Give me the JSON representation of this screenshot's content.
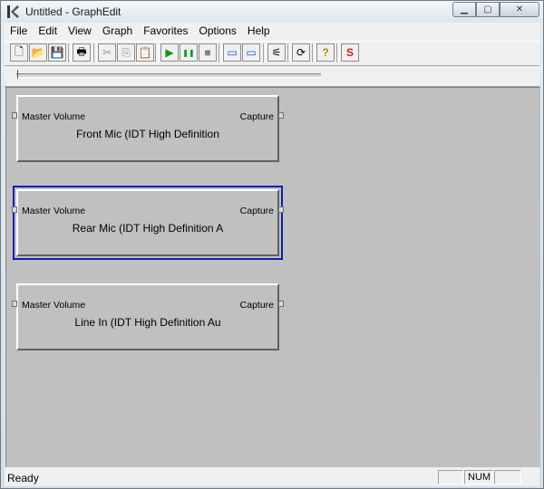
{
  "window": {
    "title": "Untitled - GraphEdit"
  },
  "menu": [
    "File",
    "Edit",
    "View",
    "Graph",
    "Favorites",
    "Options",
    "Help"
  ],
  "toolbar": [
    {
      "name": "new-icon",
      "glyph": "🗋"
    },
    {
      "name": "open-icon",
      "glyph": "📂"
    },
    {
      "name": "save-icon",
      "glyph": "💾"
    },
    {
      "name": "print-icon",
      "glyph": "🖶"
    },
    {
      "name": "cut-icon",
      "glyph": "✂"
    },
    {
      "name": "copy-icon",
      "glyph": "⎘"
    },
    {
      "name": "paste-icon",
      "glyph": "📋"
    },
    {
      "name": "play-icon",
      "glyph": "▶"
    },
    {
      "name": "pause-icon",
      "glyph": "❚❚"
    },
    {
      "name": "stop-icon",
      "glyph": "■"
    },
    {
      "name": "seek-start-icon",
      "glyph": "▭"
    },
    {
      "name": "frame-step-icon",
      "glyph": "▭"
    },
    {
      "name": "render-file-icon",
      "glyph": "⚟"
    },
    {
      "name": "refresh-icon",
      "glyph": "⟳"
    },
    {
      "name": "help-icon",
      "glyph": "?"
    },
    {
      "name": "sync-icon",
      "glyph": "S"
    }
  ],
  "filters": [
    {
      "input_pin": "Master Volume",
      "output_pin": "Capture",
      "name": "Front Mic (IDT High Definition",
      "selected": false
    },
    {
      "input_pin": "Master Volume",
      "output_pin": "Capture",
      "name": "Rear Mic (IDT High Definition A",
      "selected": true
    },
    {
      "input_pin": "Master Volume",
      "output_pin": "Capture",
      "name": "Line In (IDT High Definition Au",
      "selected": false
    }
  ],
  "status": {
    "text": "Ready",
    "num": "NUM"
  },
  "colors": {
    "graph_bg": "#c0c0c0",
    "selection": "#0a1fb5",
    "play": "#0a9a1a",
    "sync": "#cc1a1a"
  }
}
